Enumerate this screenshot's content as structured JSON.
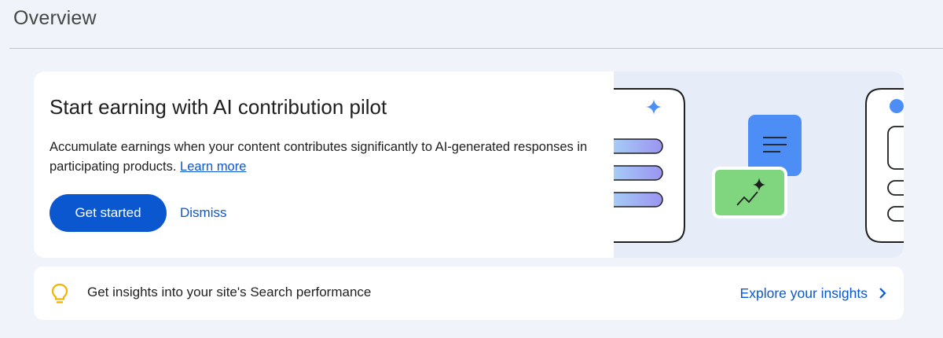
{
  "page": {
    "title": "Overview"
  },
  "promo": {
    "title": "Start earning with AI contribution pilot",
    "description": "Accumulate earnings when your content contributes significantly to AI-generated responses in participating products.",
    "learn_more": "Learn more",
    "primary_button": "Get started",
    "secondary_button": "Dismiss",
    "illustration_icons": [
      "sparkle-icon",
      "document-icon",
      "trending-chart-icon",
      "sparkle-icon"
    ]
  },
  "insights": {
    "icon": "lightbulb-icon",
    "text": "Get insights into your site's Search performance",
    "link_label": "Explore your insights",
    "link_icon": "chevron-right-icon"
  },
  "colors": {
    "background": "#f0f3f9",
    "card": "#ffffff",
    "primary": "#0b57d0",
    "illustration_bg": "#e6edf8",
    "doc_blue": "#4c8df6",
    "chart_green": "#7fd67f",
    "bulb_yellow": "#f4b400"
  }
}
